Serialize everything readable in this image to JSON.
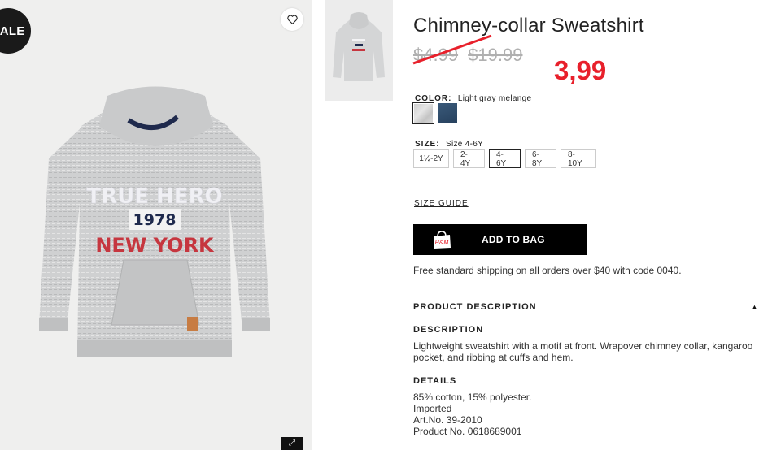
{
  "badge": {
    "sale": "SALE"
  },
  "main_image": {
    "print_line1": "TRUE HERO",
    "print_line2": "1978",
    "print_line3": "NEW YORK"
  },
  "product": {
    "title": "Chimney-collar Sweatshirt",
    "price_old_1": "$4.99",
    "price_old_2": "$19.99",
    "price_new_annotation": "3,99",
    "color_label": "COLOR:",
    "color_value": "Light gray melange",
    "size_label": "SIZE:",
    "size_value": "Size 4-6Y",
    "sizes": [
      "1½-2Y",
      "2-4Y",
      "4-6Y",
      "6-8Y",
      "8-10Y"
    ],
    "selected_size": "4-6Y",
    "size_guide": "SIZE GUIDE",
    "add_to_bag": "ADD TO BAG",
    "bag_logo": "H&M",
    "shipping": "Free standard shipping on all orders over $40 with code 0040.",
    "product_description_header": "PRODUCT DESCRIPTION",
    "description_header": "DESCRIPTION",
    "description": "Lightweight sweatshirt with a motif at front. Wrapover chimney collar, kangaroo pocket, and ribbing at cuffs and hem.",
    "details_header": "DETAILS",
    "details": [
      "85% cotton, 15% polyester.",
      "Imported",
      "Art.No. 39-2010",
      "Product No. 0618689001"
    ]
  },
  "colors": {
    "accent_red": "#e8202b",
    "swatch_gray": "#d8d8d8",
    "swatch_blue": "#2f4d6c"
  },
  "icons": {
    "favorite": "heart-icon",
    "expand": "expand-icon",
    "collapse": "triangle-up-icon",
    "bag": "shopping-bag-icon"
  }
}
